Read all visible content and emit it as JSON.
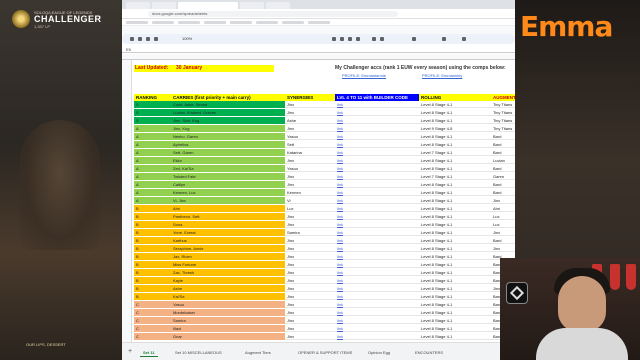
{
  "overlay": {
    "rank_sub": "SOLOQ/LEAGUE OF LEGENDS",
    "rank_title": "CHALLENGER",
    "rank_lp": "1,337 LP",
    "game_footer": "OUR LIPS, DESSERT",
    "brand_name": "Emma",
    "brand_color": "#ff8a1a"
  },
  "browser": {
    "url": "docs.google.com/spreadsheets",
    "zoom": "100%",
    "formula_ref": "E5"
  },
  "sheet": {
    "last_updated_label": "Last Updated:",
    "last_updated_value": "30 January",
    "info_line": "My Challenger accs (rank 1 EUW every season) using the comps below:",
    "profile_links": [
      "PROFILE: Emmastarmie",
      "PROFILE: Emmashiny"
    ],
    "headers": {
      "rank": "RANKING",
      "carries": "CARRIES (first priority + main carry)",
      "synergies": "SYNERGIES",
      "lv": "LVL 4 TO 11 with BUILDER CODE",
      "rolling": "ROLLING",
      "augments": "AUGMENTS"
    },
    "rank_colors": {
      "S": "#00b050",
      "A": "#92d050",
      "B": "#ffc000",
      "C": "#f4b183"
    },
    "rows": [
      {
        "rank": "S",
        "carries": "Corki, Ashe, Senna",
        "syn": "Jinx",
        "lv": "link",
        "roll": "Level 8 Stage 4-1",
        "aug": "Tiny Titans"
      },
      {
        "rank": "S",
        "carries": "Lucian, Kindred, Graves",
        "syn": "Jinx",
        "lv": "link",
        "roll": "Level 8 Stage 4-1",
        "aug": "Tiny Titans"
      },
      {
        "rank": "S",
        "carries": "Jinx, Sivir, Kog",
        "syn": "Ashe",
        "lv": "link",
        "roll": "Level 8 Stage 4-1",
        "aug": "Tiny Titans"
      },
      {
        "rank": "A",
        "carries": "Jinx, Kog",
        "syn": "Jinx",
        "lv": "link",
        "roll": "Level 9 Stage 4-5",
        "aug": "Tiny Titans"
      },
      {
        "rank": "A",
        "carries": "Neeko, Garen",
        "syn": "Yasuo",
        "lv": "link",
        "roll": "Level 8 Stage 4-1",
        "aug": "Bard"
      },
      {
        "rank": "A",
        "carries": "Aphelios",
        "syn": "Sett",
        "lv": "link",
        "roll": "Level 8 Stage 4-1",
        "aug": "Bard"
      },
      {
        "rank": "A",
        "carries": "Sett, Garen",
        "syn": "Katarina",
        "lv": "link",
        "roll": "Level 7 Stage 4-1",
        "aug": "Bard"
      },
      {
        "rank": "A",
        "carries": "Ekko",
        "syn": "Jinx",
        "lv": "link",
        "roll": "Level 8 Stage 4-1",
        "aug": "Lucian"
      },
      {
        "rank": "A",
        "carries": "Zed, Kai'Sa",
        "syn": "Yasuo",
        "lv": "link",
        "roll": "Level 8 Stage 4-1",
        "aug": "Bard"
      },
      {
        "rank": "A",
        "carries": "Twisted Fate",
        "syn": "Jinx",
        "lv": "link",
        "roll": "Level 7 Stage 4-1",
        "aug": "Garen"
      },
      {
        "rank": "A",
        "carries": "Caitlyn",
        "syn": "Jinx",
        "lv": "link",
        "roll": "Level 8 Stage 4-1",
        "aug": "Bard"
      },
      {
        "rank": "A",
        "carries": "Kennen, Lux",
        "syn": "Kennen",
        "lv": "link",
        "roll": "Level 8 Stage 4-1",
        "aug": "Bard"
      },
      {
        "rank": "A",
        "carries": "Vi, Jinx",
        "syn": "Vi",
        "lv": "link",
        "roll": "Level 8 Stage 4-1",
        "aug": "Jinx"
      },
      {
        "rank": "B",
        "carries": "Ahri",
        "syn": "Lux",
        "lv": "link",
        "roll": "Level 8 Stage 4-1",
        "aug": "Ahri"
      },
      {
        "rank": "B",
        "carries": "Pantheon, Sett",
        "syn": "Jinx",
        "lv": "link",
        "roll": "Level 8 Stage 4-1",
        "aug": "Lux"
      },
      {
        "rank": "B",
        "carries": "Sona",
        "syn": "Jinx",
        "lv": "link",
        "roll": "Level 8 Stage 4-1",
        "aug": "Lux"
      },
      {
        "rank": "B",
        "carries": "Yone, Ezreal",
        "syn": "Samira",
        "lv": "link",
        "roll": "Level 8 Stage 4-1",
        "aug": "Jinx"
      },
      {
        "rank": "B",
        "carries": "Karthus",
        "syn": "Jinx",
        "lv": "link",
        "roll": "Level 8 Stage 4-1",
        "aug": "Bard"
      },
      {
        "rank": "B",
        "carries": "Seraphine, Annie",
        "syn": "Jinx",
        "lv": "link",
        "roll": "Level 8 Stage 4-1",
        "aug": "Jinx"
      },
      {
        "rank": "B",
        "carries": "Jax, Riven",
        "syn": "Jinx",
        "lv": "link",
        "roll": "Level 8 Stage 4-1",
        "aug": "Bard"
      },
      {
        "rank": "B",
        "carries": "Miss Fortune",
        "syn": "Jinx",
        "lv": "link",
        "roll": "Level 8 Stage 4-1",
        "aug": "Bard"
      },
      {
        "rank": "B",
        "carries": "Zac, Thresh",
        "syn": "Jinx",
        "lv": "link",
        "roll": "Level 8 Stage 4-1",
        "aug": "Bard"
      },
      {
        "rank": "B",
        "carries": "Kayle",
        "syn": "Jinx",
        "lv": "link",
        "roll": "Level 8 Stage 4-1",
        "aug": "Bard"
      },
      {
        "rank": "B",
        "carries": "Ashe",
        "syn": "Jinx",
        "lv": "link",
        "roll": "Level 8 Stage 4-1",
        "aug": "Jinx"
      },
      {
        "rank": "B",
        "carries": "Kai'Sa",
        "syn": "Jinx",
        "lv": "link",
        "roll": "Level 8 Stage 4-1",
        "aug": "Bard"
      },
      {
        "rank": "C",
        "carries": "Yasuo",
        "syn": "Jinx",
        "lv": "link",
        "roll": "Level 8 Stage 4-1",
        "aug": "Bard"
      },
      {
        "rank": "C",
        "carries": "Mordekaiser",
        "syn": "Jinx",
        "lv": "link",
        "roll": "Level 8 Stage 4-1",
        "aug": "Bard"
      },
      {
        "rank": "C",
        "carries": "Samira",
        "syn": "Jinx",
        "lv": "link",
        "roll": "Level 8 Stage 4-1",
        "aug": "Bard"
      },
      {
        "rank": "C",
        "carries": "Illaoi",
        "syn": "Jinx",
        "lv": "link",
        "roll": "Level 8 Stage 4-1",
        "aug": "Bard"
      },
      {
        "rank": "C",
        "carries": "Gnar",
        "syn": "Jinx",
        "lv": "link",
        "roll": "Level 8 Stage 4-1",
        "aug": "Bard"
      }
    ],
    "tabs": [
      "Set 11",
      "Set 10 MISCELLANEOUS",
      "Augment Tiers",
      "OPENER & SUPPORT ITEMS",
      "Opinion Egg",
      "ENCOUNTERS"
    ],
    "active_tab": 0
  }
}
